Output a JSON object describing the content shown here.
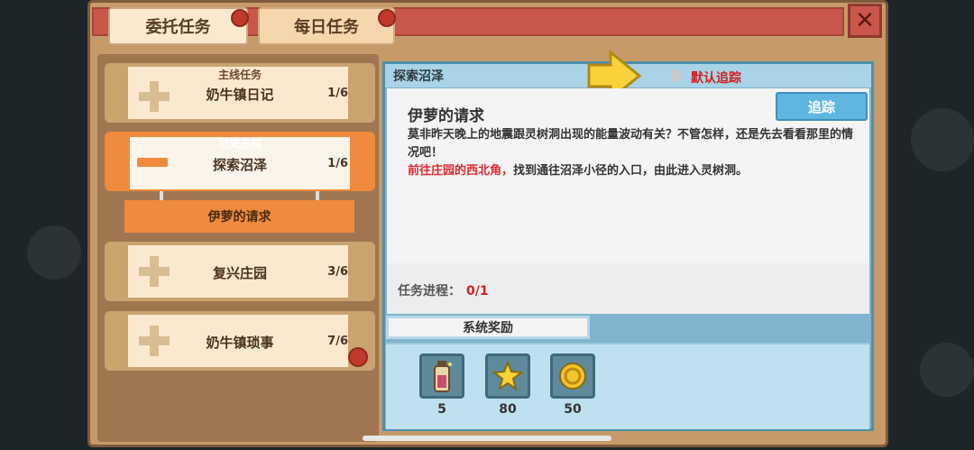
{
  "tabs": [
    {
      "label": "委托任务"
    },
    {
      "label": "每日任务"
    }
  ],
  "quests": [
    {
      "tag": "主线任务",
      "name": "奶牛镇日记",
      "count": "1/6"
    },
    {
      "tag": "分支主线",
      "name": "探索沼泽",
      "count": "1/6"
    },
    {
      "name": "复兴庄园",
      "count": "3/6"
    },
    {
      "name": "奶牛镇琐事",
      "count": "7/6"
    }
  ],
  "sub_quest": "伊萝的请求",
  "detail": {
    "header": "探索沼泽",
    "default_track": "默认追踪",
    "title": "伊萝的请求",
    "track_button": "追踪",
    "desc_line1": "莫非昨天晚上的地震跟灵树洞出现的能量波动有关？不管怎样，还是先去看看那里的情况吧！",
    "desc_red": "前往庄园的西北角，",
    "desc_rest": "找到通往沼泽小径的入口，由此进入灵树洞。",
    "progress_label": "任务进程：",
    "progress_value": "0/1",
    "reward_tab": "系统奖励"
  },
  "rewards": [
    {
      "icon": "potion-bottle-icon",
      "count": "5"
    },
    {
      "icon": "star-icon",
      "count": "80"
    },
    {
      "icon": "gold-coin-icon",
      "count": "50"
    }
  ],
  "colors": {
    "accent_orange": "#ef8a3e",
    "header_red": "#c9574a",
    "highlight_red": "#e0262d",
    "track_blue": "#5fb6e0"
  }
}
